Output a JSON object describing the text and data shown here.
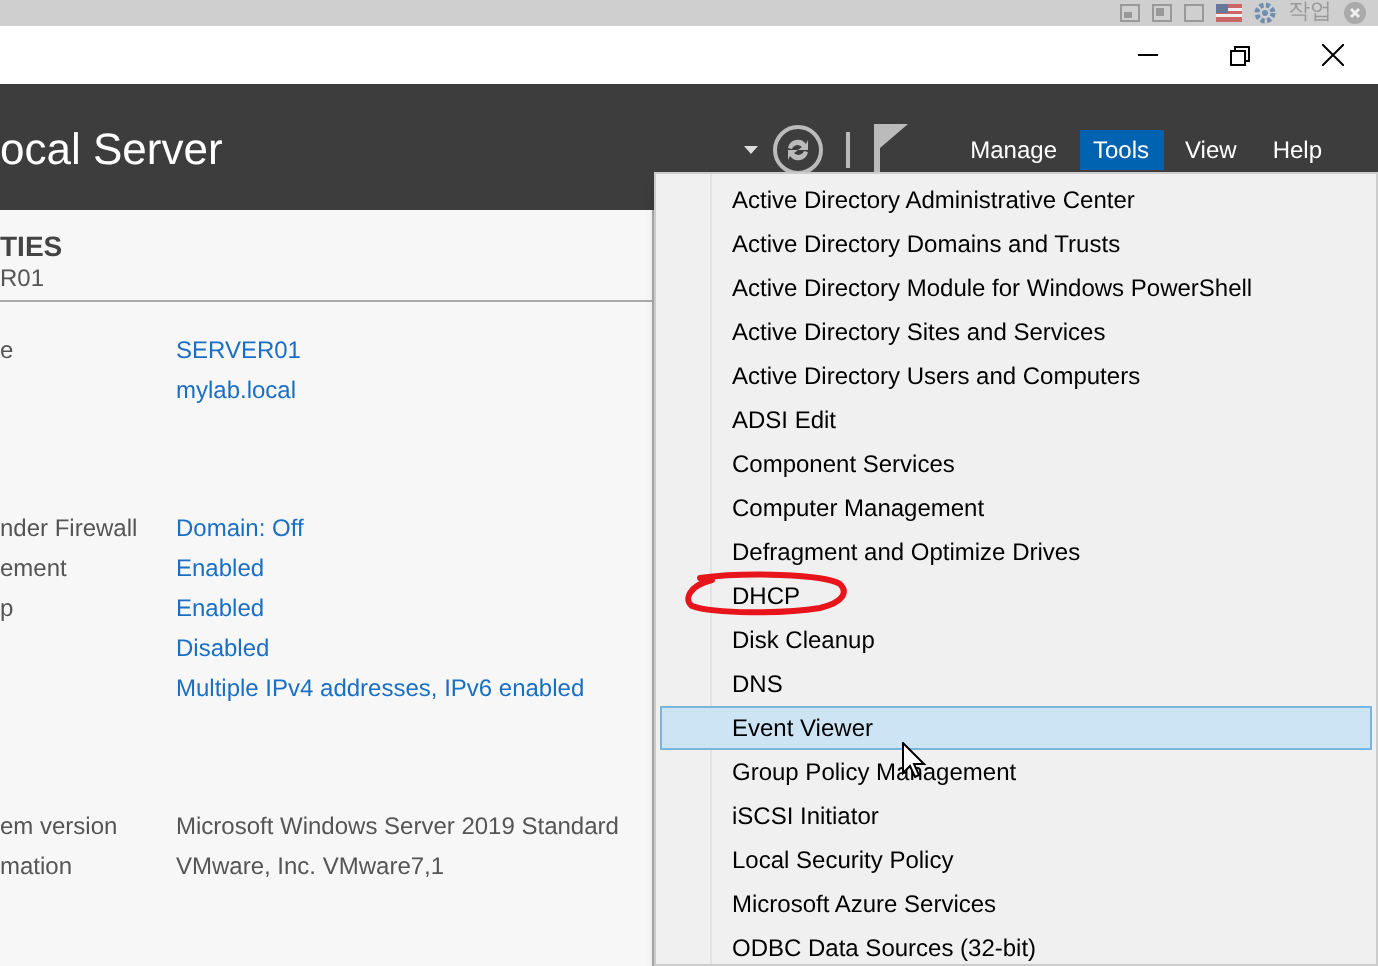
{
  "tray": {
    "label": "작업"
  },
  "header": {
    "title": "ocal Server",
    "menu": [
      {
        "label": "Manage",
        "selected": false
      },
      {
        "label": "Tools",
        "selected": true
      },
      {
        "label": "View",
        "selected": false
      },
      {
        "label": "Help",
        "selected": false
      }
    ]
  },
  "properties": {
    "heading": "TIES",
    "subheading": "R01",
    "groups": [
      [
        {
          "label": "e",
          "value": "SERVER01"
        },
        {
          "value": "mylab.local"
        }
      ],
      [
        {
          "label": "nder Firewall",
          "value": "Domain: Off"
        },
        {
          "label": "ement",
          "value": "Enabled"
        },
        {
          "label": "p",
          "value": "Enabled"
        },
        {
          "value": "Disabled"
        },
        {
          "value": "Multiple IPv4 addresses, IPv6 enabled"
        }
      ],
      [
        {
          "label": "em version",
          "value": "Microsoft Windows Server 2019 Standard",
          "kind": "plain"
        },
        {
          "label": "mation",
          "value": "VMware, Inc. VMware7,1",
          "kind": "plain"
        }
      ]
    ]
  },
  "tools_menu": {
    "items": [
      {
        "label": "Active Directory Administrative Center",
        "selected": false
      },
      {
        "label": "Active Directory Domains and Trusts",
        "selected": false
      },
      {
        "label": "Active Directory Module for Windows PowerShell",
        "selected": false
      },
      {
        "label": "Active Directory Sites and Services",
        "selected": false
      },
      {
        "label": "Active Directory Users and Computers",
        "selected": false
      },
      {
        "label": "ADSI Edit",
        "selected": false
      },
      {
        "label": "Component Services",
        "selected": false
      },
      {
        "label": "Computer Management",
        "selected": false
      },
      {
        "label": "Defragment and Optimize Drives",
        "selected": false
      },
      {
        "label": "DHCP",
        "selected": false,
        "circled": true
      },
      {
        "label": "Disk Cleanup",
        "selected": false
      },
      {
        "label": "DNS",
        "selected": false
      },
      {
        "label": "Event Viewer",
        "selected": true
      },
      {
        "label": "Group Policy Management",
        "selected": false
      },
      {
        "label": "iSCSI Initiator",
        "selected": false
      },
      {
        "label": "Local Security Policy",
        "selected": false
      },
      {
        "label": "Microsoft Azure Services",
        "selected": false
      },
      {
        "label": "ODBC Data Sources (32-bit)",
        "selected": false
      }
    ]
  }
}
